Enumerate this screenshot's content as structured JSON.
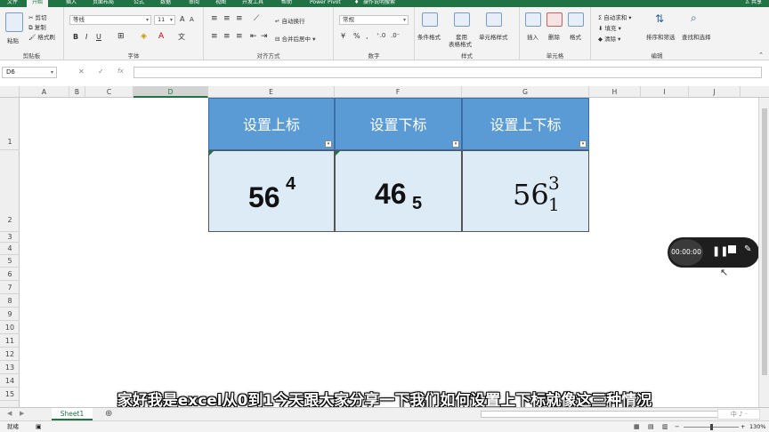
{
  "tabs": {
    "file": "文件",
    "home": "开始",
    "insert": "插入",
    "page_layout": "页面布局",
    "formulas": "公式",
    "data": "数据",
    "review": "审阅",
    "view": "视图",
    "developer": "开发工具",
    "help": "帮助",
    "power_pivot": "Power Pivot",
    "tell_me": "操作说明搜索",
    "share": "共享"
  },
  "ribbon": {
    "clipboard": {
      "paste": "粘贴",
      "cut": "剪切",
      "copy": "复制",
      "format_painter": "格式刷",
      "label": "剪贴板"
    },
    "font": {
      "name": "等线",
      "size": "11",
      "label": "字体"
    },
    "alignment": {
      "wrap": "自动换行",
      "merge": "合并后居中",
      "label": "对齐方式"
    },
    "number": {
      "format": "常规",
      "label": "数字"
    },
    "styles": {
      "conditional": "条件格式",
      "table": "套用",
      "table2": "表格格式",
      "cell_styles": "单元格样式",
      "label": "样式"
    },
    "cells": {
      "insert": "插入",
      "delete": "删除",
      "format": "格式",
      "label": "单元格"
    },
    "editing": {
      "autosum": "自动求和",
      "fill": "填充",
      "clear": "清除",
      "sort": "排序和筛选",
      "find": "查找和选择",
      "label": "编辑"
    }
  },
  "formula_bar": {
    "name_box": "D6",
    "fx": "fx",
    "value": ""
  },
  "columns": [
    "A",
    "B",
    "C",
    "D",
    "E",
    "F",
    "G",
    "H",
    "I",
    "J"
  ],
  "rows": [
    "1",
    "2",
    "3",
    "4",
    "5",
    "6",
    "7",
    "8",
    "9",
    "10",
    "11",
    "12",
    "13",
    "14",
    "15"
  ],
  "table": {
    "headers": [
      "设置上标",
      "设置下标",
      "设置上下标"
    ],
    "values": [
      {
        "base": "56",
        "sup": "4"
      },
      {
        "base": "46",
        "sub": "5"
      },
      {
        "base": "56",
        "sup": "3",
        "sub": "1"
      }
    ]
  },
  "recorder": {
    "time": "00:00:00"
  },
  "subtitle": "家好我是excel从0到1今天跟大家分享一下我们如何设置上下标就像这三种情况",
  "sheet": {
    "tab": "Sheet1",
    "add": "⊕"
  },
  "status": {
    "mode": "就绪",
    "zoom": "130%"
  },
  "colors": {
    "excel_green": "#217346",
    "header_blue": "#5b9bd5",
    "data_blue": "#ddebf7"
  }
}
